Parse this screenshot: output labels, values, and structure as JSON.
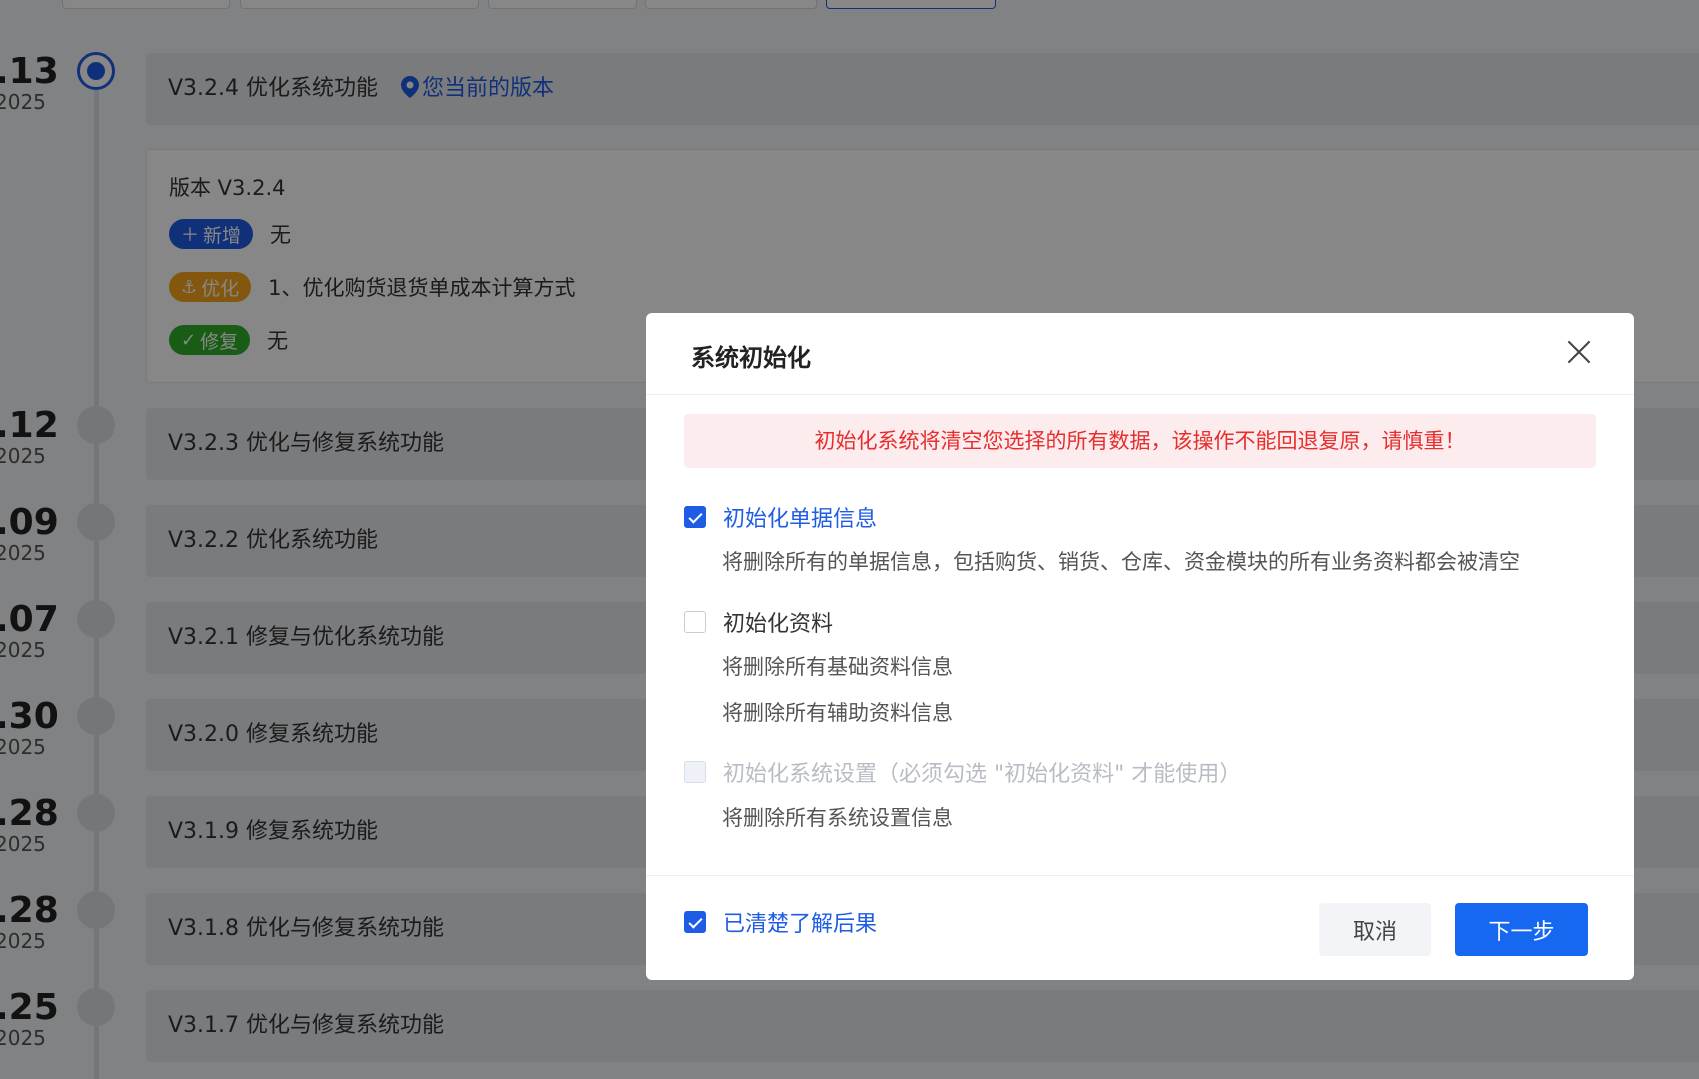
{
  "timeline": {
    "items": [
      {
        "date": ".13",
        "year": "2025",
        "title": "V3.2.4 优化系统功能",
        "active": true
      },
      {
        "date": ".12",
        "year": "2025",
        "title": "V3.2.3 优化与修复系统功能"
      },
      {
        "date": ".09",
        "year": "2025",
        "title": "V3.2.2 优化系统功能"
      },
      {
        "date": ".07",
        "year": "2025",
        "title": "V3.2.1 修复与优化系统功能"
      },
      {
        "date": ".30",
        "year": "2025",
        "title": "V3.2.0 修复系统功能"
      },
      {
        "date": ".28",
        "year": "2025",
        "title": "V3.1.9 修复系统功能"
      },
      {
        "date": ".28",
        "year": "2025",
        "title": "V3.1.8 优化与修复系统功能"
      },
      {
        "date": ".25",
        "year": "2025",
        "title": "V3.1.7 优化与修复系统功能"
      }
    ],
    "current_version_label": "您当前的版本",
    "detail": {
      "title": "版本 V3.2.4",
      "added_tag": "新增",
      "added_text": "无",
      "optimized_tag": "优化",
      "optimized_text": "1、优化购货退货单成本计算方式",
      "fixed_tag": "修复",
      "fixed_text": "无"
    }
  },
  "dialog": {
    "title": "系统初始化",
    "warning": "初始化系统将清空您选择的所有数据，该操作不能回退复原，请慎重！",
    "options": {
      "documents": {
        "label": "初始化单据信息",
        "checked": true,
        "desc": "将删除所有的单据信息，包括购货、销货、仓库、资金模块的所有业务资料都会被清空"
      },
      "data": {
        "label": "初始化资料",
        "checked": false,
        "desc1": "将删除所有基础资料信息",
        "desc2": "将删除所有辅助资料信息"
      },
      "settings": {
        "label": "初始化系统设置（必须勾选 \"初始化资料\" 才能使用）",
        "disabled": true,
        "desc": "将删除所有系统设置信息"
      }
    },
    "acknowledge": {
      "label": "已清楚了解后果",
      "checked": true
    },
    "buttons": {
      "cancel": "取消",
      "next": "下一步"
    }
  },
  "colors": {
    "primary": "#1f5ce6",
    "danger": "#e62e2e",
    "optimize": "#f7a519",
    "fix": "#2fae2a"
  }
}
